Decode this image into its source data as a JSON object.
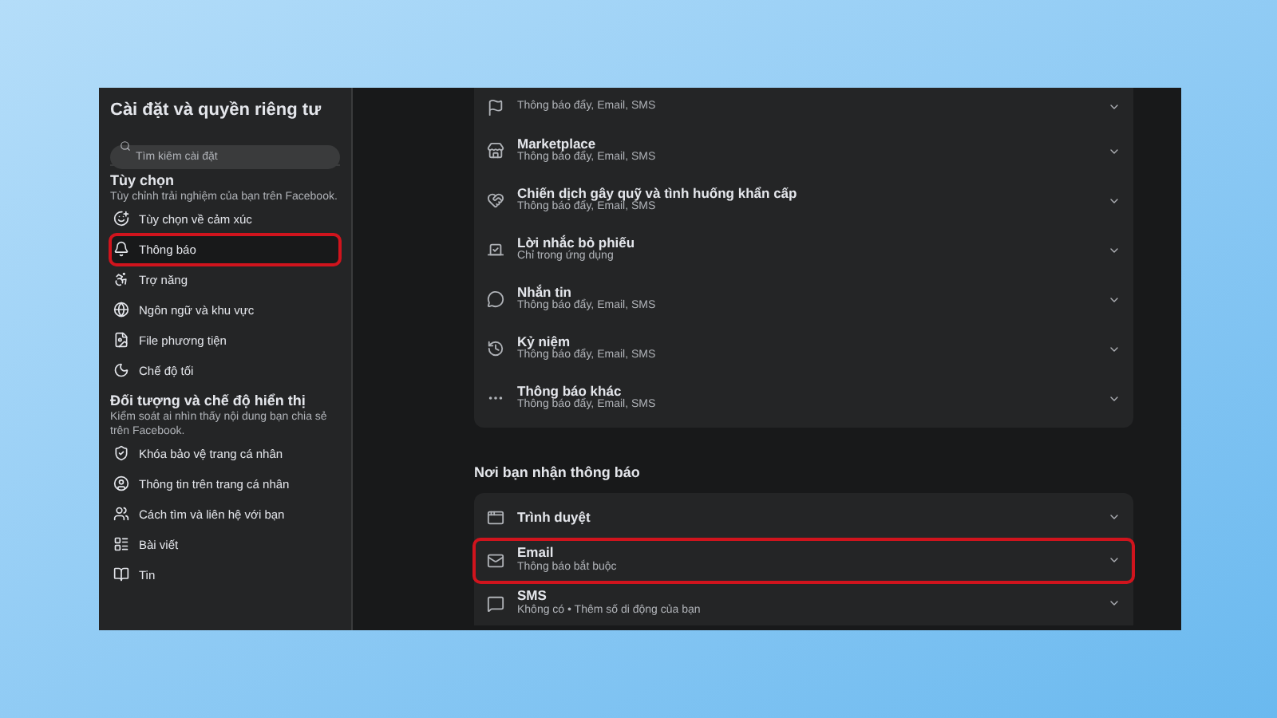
{
  "sidebar": {
    "title": "Cài đặt và quyền riêng tư",
    "search": {
      "placeholder": "Tìm kiếm cài đặt"
    },
    "sections": [
      {
        "title": "Tùy chọn",
        "description": "Tùy chỉnh trải nghiệm của bạn trên Facebook.",
        "items": [
          {
            "label": "Tùy chọn về cảm xúc",
            "selected": false,
            "highlighted": false
          },
          {
            "label": "Thông báo",
            "selected": true,
            "highlighted": true
          },
          {
            "label": "Trợ năng",
            "selected": false,
            "highlighted": false
          },
          {
            "label": "Ngôn ngữ và khu vực",
            "selected": false,
            "highlighted": false
          },
          {
            "label": "File phương tiện",
            "selected": false,
            "highlighted": false
          },
          {
            "label": "Chế độ tối",
            "selected": false,
            "highlighted": false
          }
        ]
      },
      {
        "title": "Đối tượng và chế độ hiển thị",
        "description": "Kiểm soát ai nhìn thấy nội dung bạn chia sẻ trên Facebook.",
        "items": [
          {
            "label": "Khóa bảo vệ trang cá nhân",
            "selected": false,
            "highlighted": false
          },
          {
            "label": "Thông tin trên trang cá nhân",
            "selected": false,
            "highlighted": false
          },
          {
            "label": "Cách tìm và liên hệ với bạn",
            "selected": false,
            "highlighted": false
          },
          {
            "label": "Bài viết",
            "selected": false,
            "highlighted": false
          },
          {
            "label": "Tin",
            "selected": false,
            "highlighted": false
          }
        ]
      }
    ]
  },
  "notification_types": [
    {
      "subtitle": "Thông báo đẩy, Email, SMS"
    },
    {
      "title": "Marketplace",
      "subtitle": "Thông báo đẩy, Email, SMS"
    },
    {
      "title": "Chiến dịch gây quỹ và tình huống khẩn cấp",
      "subtitle": "Thông báo đẩy, Email, SMS"
    },
    {
      "title": "Lời nhắc bỏ phiếu",
      "subtitle": "Chỉ trong ứng dụng"
    },
    {
      "title": "Nhắn tin",
      "subtitle": "Thông báo đẩy, Email, SMS"
    },
    {
      "title": "Kỷ niệm",
      "subtitle": "Thông báo đẩy, Email, SMS"
    },
    {
      "title": "Thông báo khác",
      "subtitle": "Thông báo đẩy, Email, SMS"
    }
  ],
  "delivery": {
    "heading": "Nơi bạn nhận thông báo",
    "items": [
      {
        "title": "Trình duyệt",
        "highlighted": false
      },
      {
        "title": "Email",
        "subtitle": "Thông báo bắt buộc",
        "highlighted": true
      },
      {
        "title": "SMS",
        "subtitle": "Không có • Thêm số di động của bạn",
        "highlighted": false
      }
    ]
  }
}
